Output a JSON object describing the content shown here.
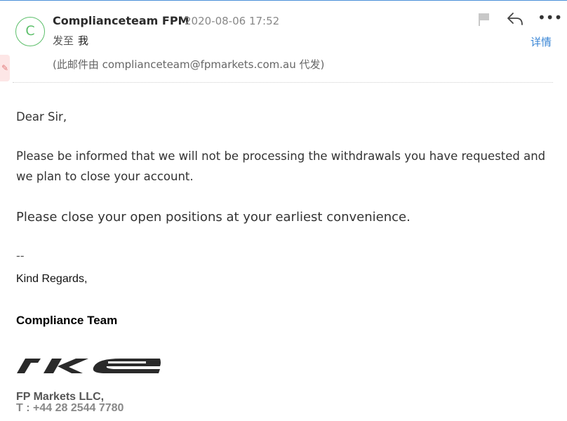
{
  "header": {
    "avatar_letter": "C",
    "sender_name": "Complianceteam FPM",
    "date": "2020-08-06 17:52",
    "to_label": "发至",
    "to_value": "我",
    "via_text": "(此邮件由 complianceteam@fpmarkets.com.au 代发)",
    "details_label": "详情",
    "more_label": "•••"
  },
  "body": {
    "greeting": "Dear Sir,",
    "paragraph1": "Please be informed that we will not be processing the withdrawals you have requested and we plan to close your account.",
    "paragraph2": "Please close your open positions at your earliest convenience."
  },
  "signature": {
    "dash": "--",
    "kind_regards": "Kind Regards,",
    "team": "Compliance Team",
    "logo_text": "rke",
    "company": "FP Markets LLC,",
    "phone": "T : +44 28 2544 7780"
  },
  "colors": {
    "accent": "#3a86d6",
    "avatar": "#5cbf6a",
    "side_tab": "#fde6e6"
  }
}
